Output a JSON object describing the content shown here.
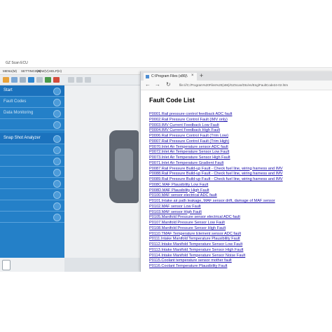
{
  "app": {
    "title": "GZ Scan ECU",
    "menu": [
      "MENU(M)",
      "SETTINGS(S)",
      "VIEW(V)",
      "HELP(H)"
    ],
    "sidebar": [
      {
        "label": "Start",
        "header": true
      },
      {
        "label": "Fault Codes",
        "header": false
      },
      {
        "label": "Data Monitoring",
        "header": false
      },
      {
        "label": "",
        "header": false
      },
      {
        "label": "Snap Shot Analyzer",
        "header": true
      },
      {
        "label": "",
        "header": false
      },
      {
        "label": "",
        "header": false
      },
      {
        "label": "",
        "header": false
      },
      {
        "label": "",
        "header": false
      },
      {
        "label": "",
        "header": false
      },
      {
        "label": "",
        "header": false
      },
      {
        "label": "",
        "header": false
      }
    ]
  },
  "browser": {
    "tab_title": "C:\\Program Files (x86)\\",
    "tab_close": "×",
    "new_tab": "+",
    "back": "←",
    "forward": "→",
    "refresh": "↻",
    "address": "file:///C:/Program%20Files%20(x86)/GZScan/Dtc/en/Eng/FaultCode24-02.htm"
  },
  "page": {
    "title": "Fault Code List",
    "faults": [
      "P0001.Rail pressure control feedback ADC fault",
      "P0002.Rail Pressure Control Fault (IMV only)",
      "P0003.IMV Current Feedback Low Fault",
      "P0004.IMV Current Feedback High Fault",
      "P0006.Rail Pressure Control Fault (Trim Low)",
      "P0007.Rail Pressure Control Fault (Trim High)",
      "P0070.Inlet Air Temperature sensor ADC fault",
      "P0072.Inlet Air Temperature Sensor Low Fault",
      "P0073.Inlet Air Temperature Sensor High Fault",
      "P0071.Inlet Air Temperature Gradient Fault",
      "P0087.Rail Pressure Build-up Fault - Check fuel line, wiring harness and IMV",
      "P0088.Rail Pressure Build-up Fault - Check fuel line, wiring harness and IMV",
      "P0089.Rail Pressure Build-up Fault - Check fuel line, wiring harness and IMV",
      "P008C.MAF Plausibility Low Fault",
      "P008D.MAF Plausibility High Fault",
      "P0100.MAF sensor electrical ADC fault",
      "P0101.Intake air path leakage, MAF sensor drift, damage of MAF sensor",
      "P0102.MAF sensor Low Fault",
      "P0103.MAF sensor High Fault",
      "P0105.Manifold Pressure sensor electrical ADC fault",
      "P0107.Manifold Pressure Sensor Low Fault",
      "P0108.Manifold Pressure Sensor High Fault",
      "P0110.TMAF Temperature Element sensor ADC fault",
      "P0111.Intake Manifold Temperature Plausibility Fault",
      "P0112.Intake Manifold Temperature Sensor Low Fault",
      "P0113.Intake Manifold Temperature Sensor High Fault",
      "P0114.Intake Manifold Temperature Sensor Noise Fault",
      "P0115.Coolant temperature sensor mother fault",
      "P0116.Coolant Temperature Plausibility Fault"
    ]
  }
}
